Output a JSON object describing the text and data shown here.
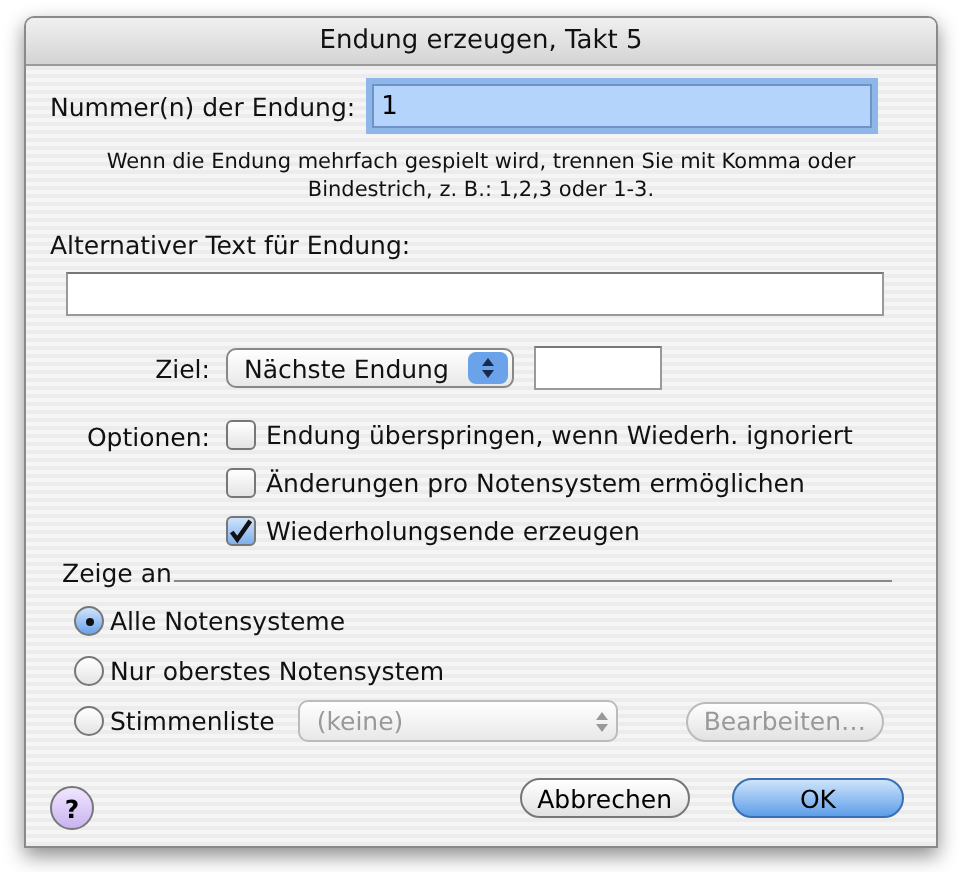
{
  "window": {
    "title": "Endung erzeugen, Takt 5"
  },
  "number_field": {
    "label": "Nummer(n) der Endung:",
    "value": "1",
    "focused": true
  },
  "hint": "Wenn die Endung mehrfach gespielt wird, trennen Sie mit Komma oder Bindestrich, z. B.: 1,2,3 oder 1-3.",
  "alt_text": {
    "label": "Alternativer Text für Endung:"
  },
  "target": {
    "label": "Ziel:",
    "value": "Nächste Endung"
  },
  "options": {
    "label": "Optionen:",
    "items": [
      {
        "label": "Endung überspringen, wenn Wiederh. ignoriert",
        "checked": false
      },
      {
        "label": "Änderungen pro Notensystem ermöglichen",
        "checked": false
      },
      {
        "label": "Wiederholungsende erzeugen",
        "checked": true
      }
    ]
  },
  "show": {
    "label": "Zeige an",
    "items": [
      {
        "label": "Alle Notensysteme",
        "selected": true
      },
      {
        "label": "Nur oberstes Notensystem",
        "selected": false
      },
      {
        "label": "Stimmenliste",
        "selected": false,
        "list": {
          "value": "(keine)",
          "disabled": true
        },
        "edit_button": {
          "label": "Bearbeiten…",
          "disabled": true
        }
      }
    ]
  },
  "help_button": {
    "label": "?"
  },
  "buttons": [
    {
      "label": "Abbrechen",
      "default": false
    },
    {
      "label": "OK",
      "default": true
    }
  ]
}
